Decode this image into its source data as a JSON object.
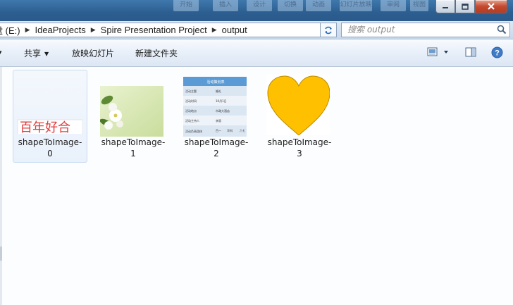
{
  "titlebar": {
    "background_menu": [
      "开始",
      "插入",
      "设计",
      "切换",
      "动画",
      "幻灯片放映",
      "审阅",
      "视图"
    ],
    "window_buttons": [
      "minimize",
      "maximize",
      "close"
    ]
  },
  "address": {
    "crumbs": [
      "盘 (E:)",
      "IdeaProjects",
      "Spire Presentation Project",
      "output"
    ],
    "search_placeholder": "搜索 output"
  },
  "toolbar": {
    "share_label": "共享",
    "slideshow_label": "放映幻灯片",
    "new_folder_label": "新建文件夹",
    "icons": [
      "view-icon",
      "preview-pane-icon",
      "help-icon"
    ]
  },
  "files": [
    {
      "name_line1": "shapeToImage-",
      "name_line2": "0",
      "thumb_text": "百年好合",
      "selected": true
    },
    {
      "name_line1": "shapeToImage-",
      "name_line2": "1",
      "selected": false
    },
    {
      "name_line1": "shapeToImage-",
      "name_line2": "2",
      "selected": false,
      "table": {
        "title": "活动策划表",
        "rows": [
          [
            "活动主题",
            "婚礼"
          ],
          [
            "活动时间",
            "10月1日"
          ],
          [
            "活动地点",
            "市政大酒店"
          ],
          [
            "活动主持人",
            "李丽"
          ],
          [
            "活动负责团体",
            "百一",
            "华科",
            "六七"
          ]
        ]
      }
    },
    {
      "name_line1": "shapeToImage-",
      "name_line2": "3",
      "selected": false
    }
  ],
  "colors": {
    "accent": "#2f6fb7",
    "heart": "#ffc000",
    "heart_stroke": "#b98b00",
    "text_red": "#e03c3c",
    "table_header": "#5b9bd5",
    "table_row": "#dbe6f3"
  }
}
